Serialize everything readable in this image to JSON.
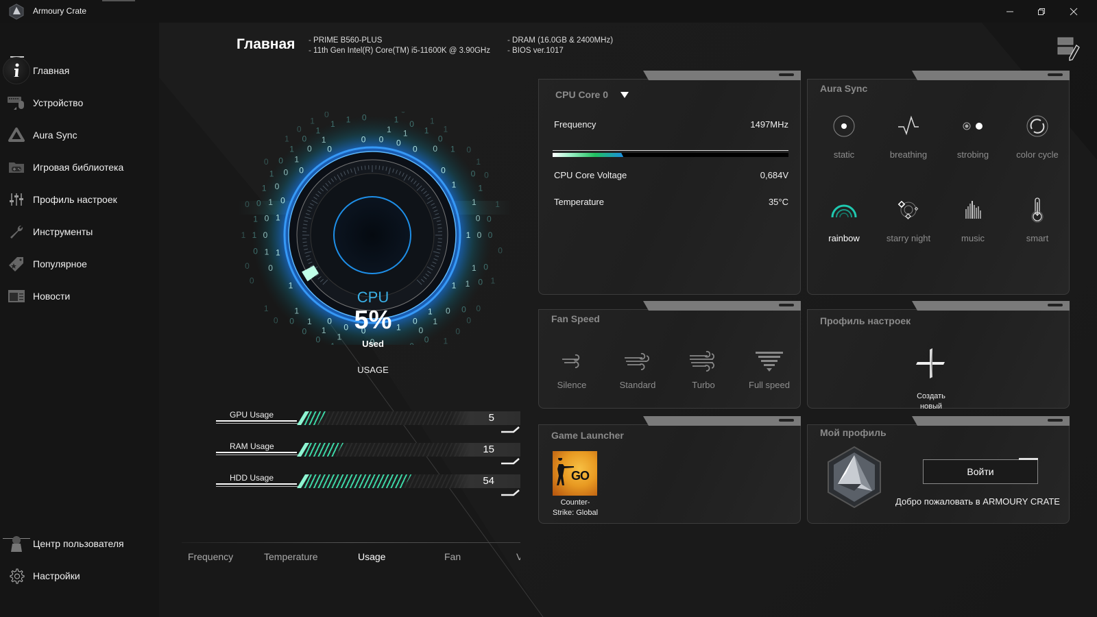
{
  "window": {
    "title": "Armoury Crate",
    "controls": {
      "minimize": "minimize",
      "restore": "restore",
      "close": "close"
    }
  },
  "sidebar": {
    "items": [
      {
        "label": "Главная",
        "icon": "info-icon",
        "active": true
      },
      {
        "label": "Устройство",
        "icon": "keyboard-mouse-icon"
      },
      {
        "label": "Aura Sync",
        "icon": "aura-triangle-icon"
      },
      {
        "label": "Игровая библиотека",
        "icon": "gamepad-folder-icon"
      },
      {
        "label": "Профиль настроек",
        "icon": "sliders-icon"
      },
      {
        "label": "Инструменты",
        "icon": "wrench-icon"
      },
      {
        "label": "Популярное",
        "icon": "tag-star-icon"
      },
      {
        "label": "Новости",
        "icon": "news-icon"
      }
    ],
    "bottom_items": [
      {
        "label": "Центр пользователя",
        "icon": "user-icon"
      },
      {
        "label": "Настройки",
        "icon": "gear-icon"
      }
    ]
  },
  "header": {
    "title": "Главная",
    "sysinfo_left": [
      "PRIME B560-PLUS",
      "11th Gen Intel(R) Core(TM) i5-11600K @ 3.90GHz"
    ],
    "sysinfo_right": [
      "DRAM (16.0GB & 2400MHz)",
      "BIOS ver.1017"
    ]
  },
  "gauge": {
    "label": "CPU",
    "value_text": "5%",
    "value_percent": 5,
    "sub_label": "Used",
    "caption": "USAGE",
    "accent": "#3ab0e6"
  },
  "usage_bars": [
    {
      "label": "GPU Usage",
      "value": "5",
      "percent": 5
    },
    {
      "label": "RAM Usage",
      "value": "15",
      "percent": 15
    },
    {
      "label": "HDD Usage",
      "value": "54",
      "percent": 54
    }
  ],
  "monitor_tabs": [
    {
      "label": "Frequency"
    },
    {
      "label": "Temperature"
    },
    {
      "label": "Usage",
      "active": true
    },
    {
      "label": "Fan"
    },
    {
      "label": "V"
    }
  ],
  "cpu_panel": {
    "selected_core": "CPU Core 0",
    "rows": [
      {
        "label": "Frequency",
        "value": "1497MHz"
      },
      {
        "label": "CPU Core Voltage",
        "value": "0,684V"
      },
      {
        "label": "Temperature",
        "value": "35°C"
      }
    ],
    "frequency_fill": 0.3
  },
  "aura_panel": {
    "title": "Aura Sync",
    "effects": [
      {
        "label": "static",
        "icon": "static-dot-icon"
      },
      {
        "label": "breathing",
        "icon": "pulse-wave-icon"
      },
      {
        "label": "strobing",
        "icon": "strobe-dots-icon"
      },
      {
        "label": "color cycle",
        "icon": "cycle-ring-icon"
      },
      {
        "label": "rainbow",
        "icon": "rainbow-arcs-icon",
        "active": true
      },
      {
        "label": "starry night",
        "icon": "starry-orbit-icon"
      },
      {
        "label": "music",
        "icon": "equalizer-icon"
      },
      {
        "label": "smart",
        "icon": "thermometer-icon"
      }
    ],
    "active_color": "#1fc9b0"
  },
  "fan_panel": {
    "title": "Fan Speed",
    "modes": [
      {
        "label": "Silence",
        "icon": "wind-light-icon"
      },
      {
        "label": "Standard",
        "icon": "wind-medium-icon"
      },
      {
        "label": "Turbo",
        "icon": "wind-strong-icon"
      },
      {
        "label": "Full speed",
        "icon": "tornado-icon"
      }
    ]
  },
  "profile_panel": {
    "title": "Профиль настроек",
    "create_label_1": "Создать",
    "create_label_2": "новый"
  },
  "game_panel": {
    "title": "Game Launcher",
    "games": [
      {
        "name_1": "Counter-",
        "name_2": "Strike: Global",
        "tile_text": "GO"
      }
    ]
  },
  "my_profile_panel": {
    "title": "Мой профиль",
    "login_label": "Войти",
    "welcome": "Добро пожаловать в ARMOURY CRATE"
  }
}
